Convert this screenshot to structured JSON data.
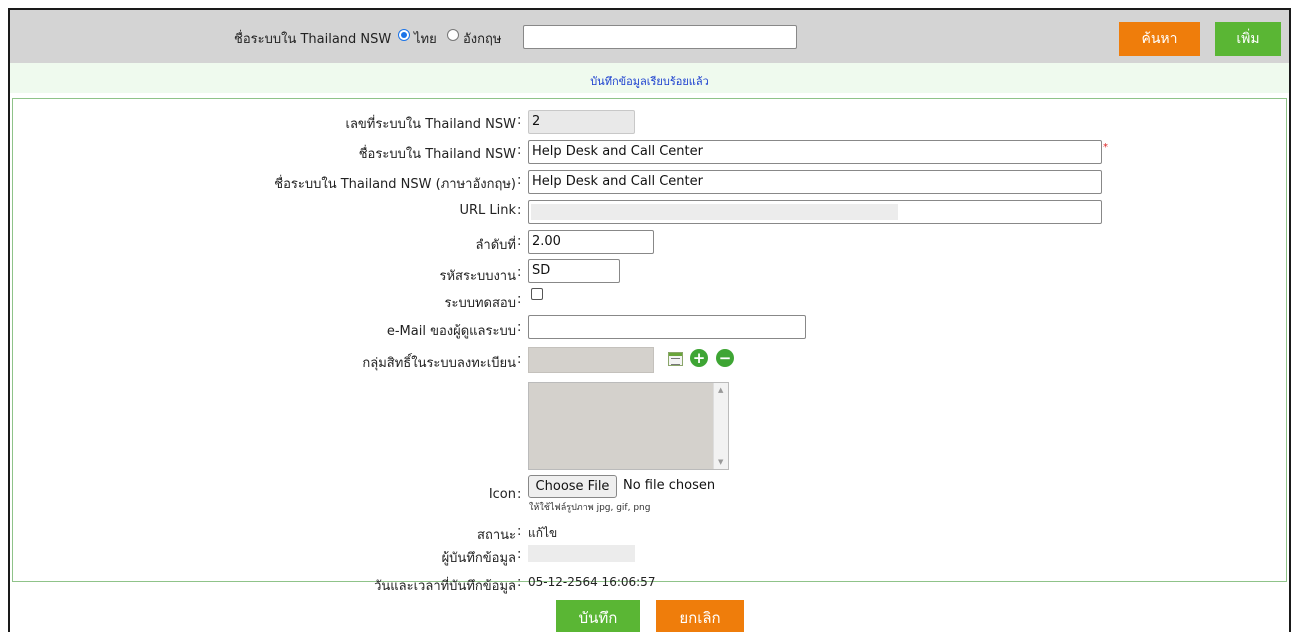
{
  "search": {
    "label": "ชื่อระบบใน Thailand NSW",
    "option_thai": "ไทย",
    "option_english": "อังกฤษ",
    "selected_option": "ไทย",
    "value": "",
    "search_button": "ค้นหา",
    "add_button": "เพิ่ม"
  },
  "message": "บันทึกข้อมูลเรียบร้อยแล้ว",
  "form": {
    "system_no": {
      "label": "เลขที่ระบบใน Thailand NSW",
      "value": "2"
    },
    "system_name": {
      "label": "ชื่อระบบใน Thailand NSW",
      "value": "Help Desk and Call Center",
      "required_mark": "*"
    },
    "system_name_en": {
      "label": "ชื่อระบบใน Thailand NSW (ภาษาอังกฤษ)",
      "value": "Help Desk and Call Center"
    },
    "url_link": {
      "label": "URL Link",
      "value": ""
    },
    "order": {
      "label": "ลำดับที่",
      "value": "2.00"
    },
    "system_code": {
      "label": "รหัสระบบงาน",
      "value": "SD"
    },
    "test_system": {
      "label": "ระบบทดสอบ",
      "checked": false
    },
    "admin_email": {
      "label": "e-Mail ของผู้ดูแลระบบ",
      "value": ""
    },
    "permission_group": {
      "label": "กลุ่มสิทธิ์ในระบบลงทะเบียน",
      "value": "",
      "icons": [
        "list-icon",
        "plus-circle-icon",
        "minus-circle-icon"
      ]
    },
    "icon": {
      "label": "Icon",
      "button": "Choose File",
      "status": "No file chosen",
      "hint": "ให้ใช้ไฟล์รูปภาพ jpg, gif, png"
    },
    "status": {
      "label": "สถานะ",
      "value": "แก้ไข"
    },
    "recorded_by": {
      "label": "ผู้บันทึกข้อมูล",
      "value": ""
    },
    "recorded_at": {
      "label": "วันและเวลาที่บันทึกข้อมูล",
      "value": "05-12-2564 16:06:57"
    }
  },
  "actions": {
    "save": "บันทึก",
    "cancel": "ยกเลิก"
  },
  "colors": {
    "orange": "#ef7d0b",
    "green": "#5ab634",
    "message_blue": "#1b3fcf",
    "toolbar_gray": "#d4d4d4"
  }
}
